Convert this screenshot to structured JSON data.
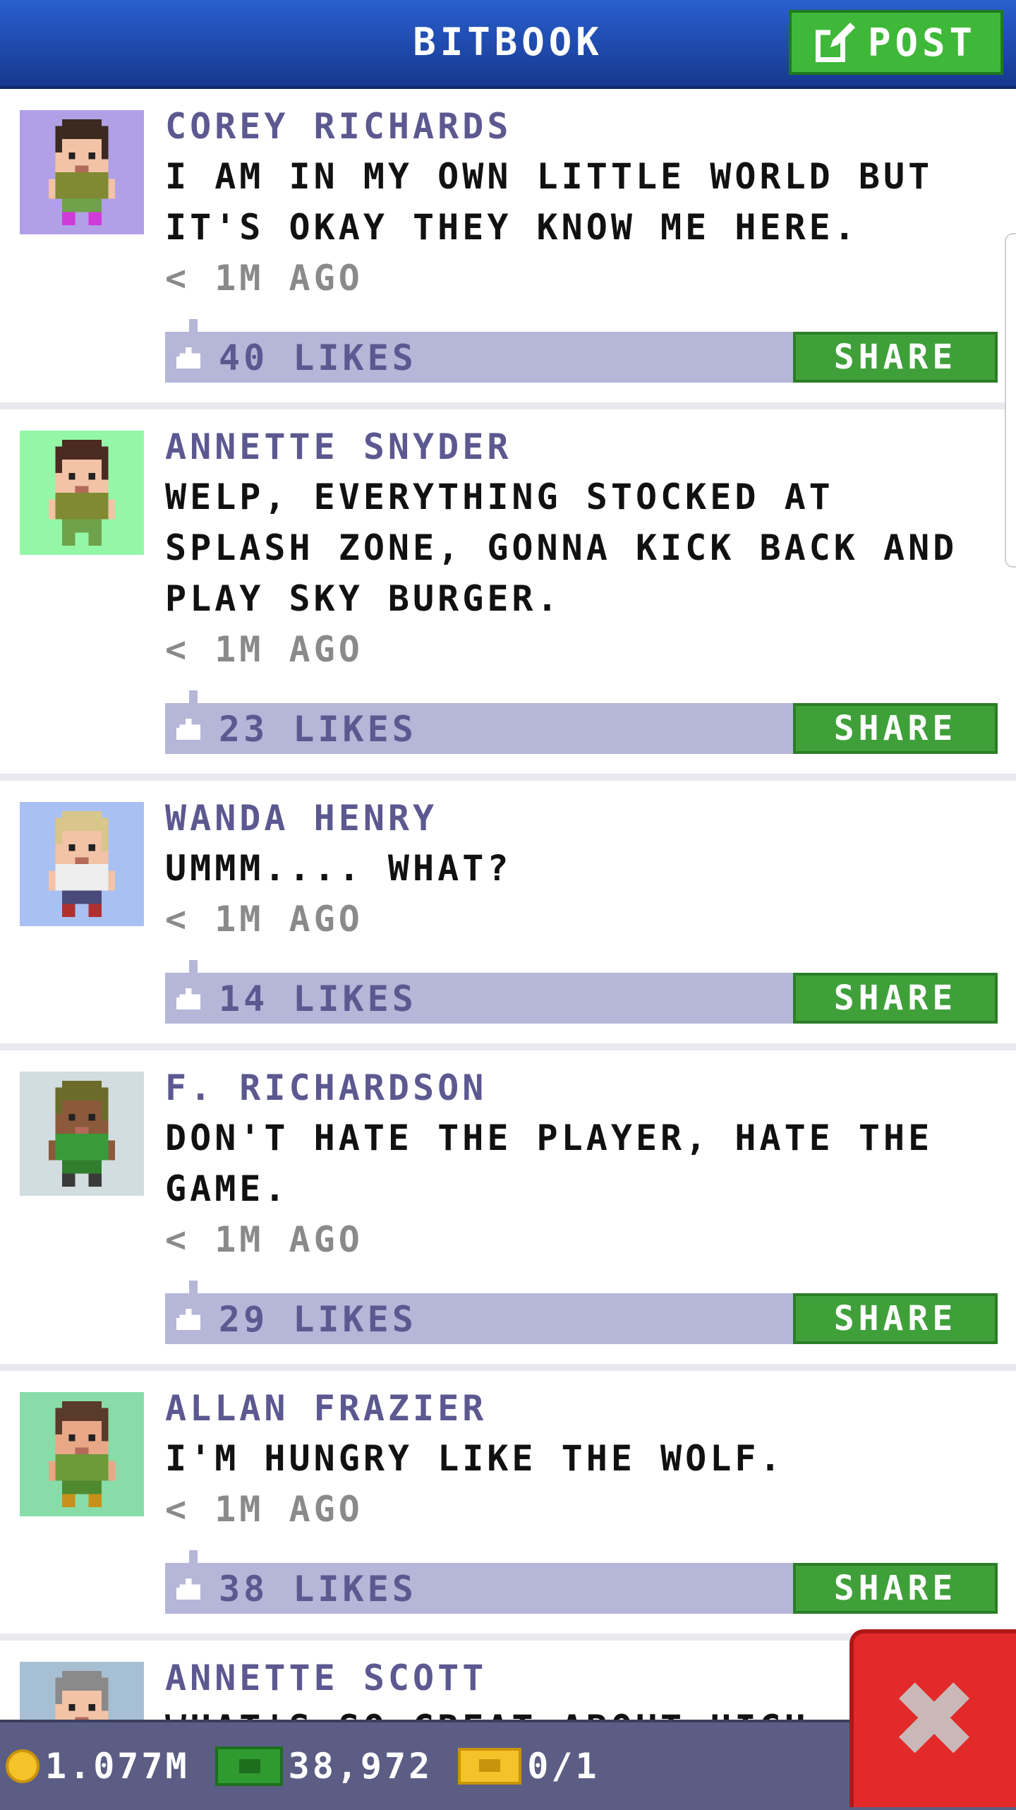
{
  "header": {
    "title": "BITBOOK",
    "post_label": "POST",
    "post_icon": "edit-icon"
  },
  "posts": [
    {
      "name": "COREY RICHARDS",
      "message": "I AM IN MY OWN LITTLE WORLD BUT IT'S OKAY THEY KNOW ME HERE.",
      "time": "< 1M AGO",
      "likes": "40 LIKES",
      "share_label": "SHARE",
      "avatar_bg": "#b1a0e6",
      "skin": "#f2c3a6",
      "hair": "#3a2a20",
      "shirt": "#7f8a32",
      "pants": "#6fa24a",
      "shoes": "#d03ad8"
    },
    {
      "name": "ANNETTE SNYDER",
      "message": "WELP, EVERYTHING STOCKED AT SPLASH ZONE, GONNA KICK BACK AND PLAY SKY BURGER.",
      "time": "< 1M AGO",
      "likes": "23 LIKES",
      "share_label": "SHARE",
      "avatar_bg": "#94f7a8",
      "skin": "#f2c3a6",
      "hair": "#4a2a22",
      "shirt": "#7f8a32",
      "pants": "#6fa24a",
      "shoes": "#6fa24a"
    },
    {
      "name": "WANDA HENRY",
      "message": "UMMM....  WHAT?",
      "time": "< 1M AGO",
      "likes": "14 LIKES",
      "share_label": "SHARE",
      "avatar_bg": "#a9c0f2",
      "skin": "#f2c3a6",
      "hair": "#d8c68a",
      "shirt": "#eeeeee",
      "pants": "#4a4a7a",
      "shoes": "#b03030"
    },
    {
      "name": "F. RICHARDSON",
      "message": "DON'T HATE THE PLAYER, HATE THE GAME.",
      "time": "< 1M AGO",
      "likes": "29 LIKES",
      "share_label": "SHARE",
      "avatar_bg": "#d2dde0",
      "skin": "#8a5a3a",
      "hair": "#6b6b2a",
      "shirt": "#3a9a3a",
      "pants": "#2f7f2f",
      "shoes": "#3a3a3a"
    },
    {
      "name": "ALLAN FRAZIER",
      "message": "I'M HUNGRY LIKE THE WOLF.",
      "time": "< 1M AGO",
      "likes": "38 LIKES",
      "share_label": "SHARE",
      "avatar_bg": "#88dca8",
      "skin": "#e8a888",
      "hair": "#5a3a2a",
      "shirt": "#6f9a3a",
      "pants": "#4f8a2f",
      "shoes": "#c8901a"
    },
    {
      "name": "ANNETTE SCOTT",
      "message": "WHAT'S SO GREAT ABOUT HIGH",
      "time": "",
      "likes": "",
      "share_label": "",
      "avatar_bg": "#a7bfd2",
      "skin": "#f2c3a6",
      "hair": "#8a8a8a",
      "shirt": "#1e3a8a",
      "pants": "#1e3a8a",
      "shoes": "#d03ad8"
    }
  ],
  "bottom_bar": {
    "coins": "1.077M",
    "bux": "38,972",
    "tickets": "0/1",
    "coin_icon": "coin-icon",
    "bux_icon": "bux-icon",
    "ticket_icon": "ticket-icon"
  },
  "close_button": {
    "label": "✖",
    "icon": "close-icon"
  }
}
